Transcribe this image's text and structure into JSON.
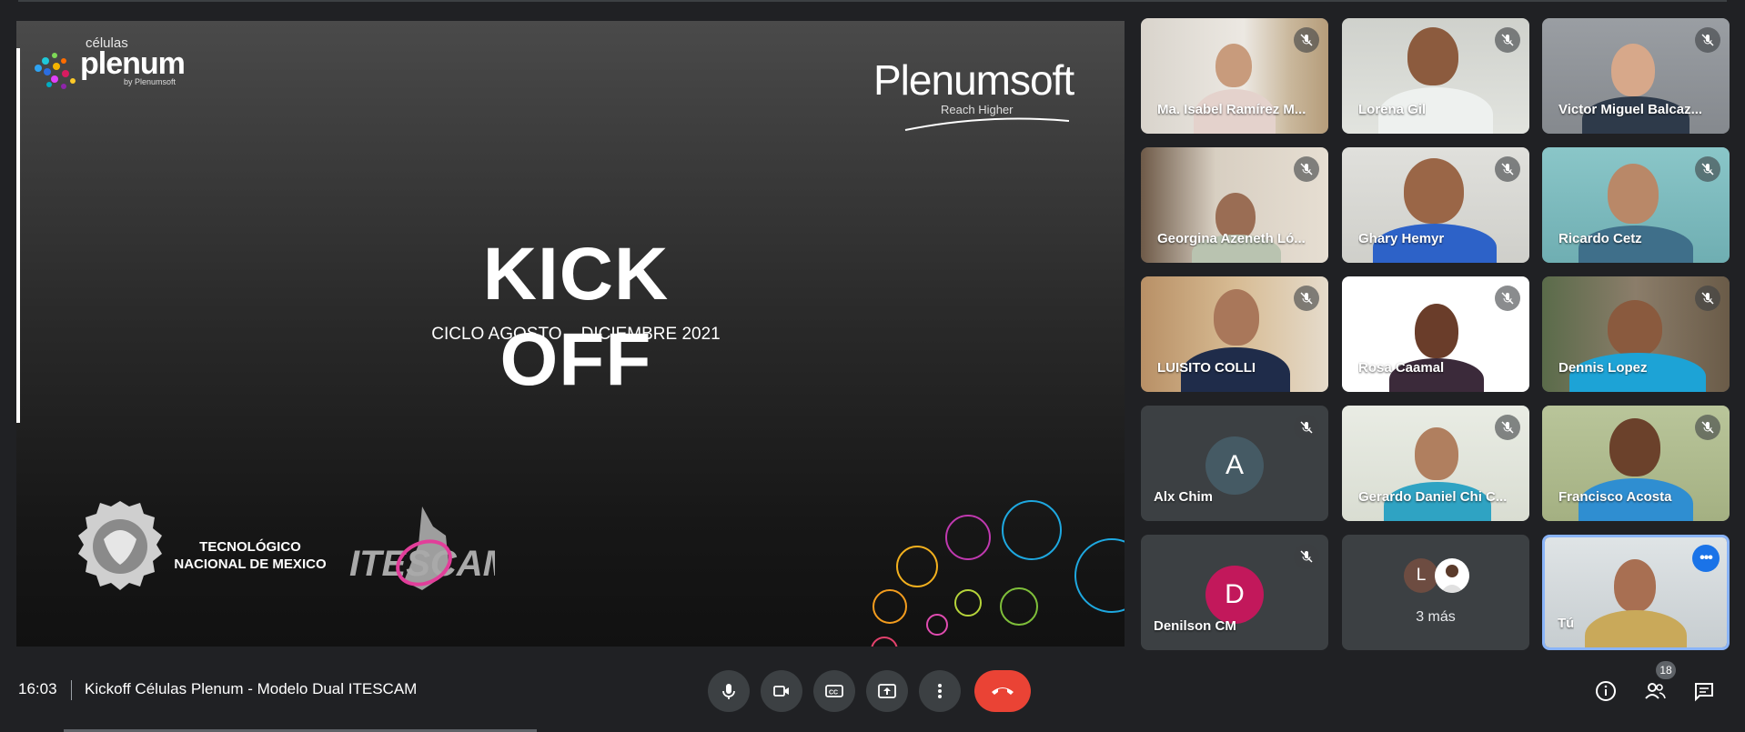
{
  "slide": {
    "brand_top": "células",
    "brand_main": "plenum",
    "brand_by": "by Plenumsoft",
    "partner_logo": "Plenumsoft",
    "partner_tagline": "Reach Higher",
    "headline": "KICK OFF",
    "subtitle": "CICLO AGOSTO – DICIEMBRE 2021",
    "institution_line1": "TECNOLÓGICO",
    "institution_line2": "NACIONAL DE MEXICO",
    "logo_text": "ITESCAM"
  },
  "participants": [
    {
      "name": "Ma. Isabel Ramírez M...",
      "muted": true
    },
    {
      "name": "Lorena Gil",
      "muted": true
    },
    {
      "name": "Victor Miguel Balcaz...",
      "muted": true
    },
    {
      "name": "Georgina Azeneth Ló...",
      "muted": true
    },
    {
      "name": "Ghary Hemyr",
      "muted": true
    },
    {
      "name": "Ricardo Cetz",
      "muted": true
    },
    {
      "name": "LUISITO COLLI",
      "muted": true
    },
    {
      "name": "Rosa Caamal",
      "muted": true
    },
    {
      "name": "Dennis Lopez",
      "muted": true
    },
    {
      "name": "Alx Chim",
      "initial": "A",
      "muted": true
    },
    {
      "name": "Gerardo Daniel Chi C...",
      "muted": true
    },
    {
      "name": "Francisco Acosta",
      "muted": true
    },
    {
      "name": "Denilson CM",
      "initial": "D",
      "muted": true
    }
  ],
  "more_tile": {
    "initial": "L",
    "label": "3 más"
  },
  "self_tile": {
    "name": "Tú"
  },
  "footer": {
    "time": "16:03",
    "meeting_title": "Kickoff Células Plenum - Modelo Dual ITESCAM",
    "participant_count": "18"
  },
  "colors": {
    "background": "#202124",
    "end_call": "#ea4335",
    "self_highlight": "#8ab4f8",
    "accent": "#1a73e8"
  },
  "icons": [
    "mic-icon",
    "camera-icon",
    "captions-icon",
    "present-icon",
    "more-options-icon",
    "end-call-icon",
    "info-icon",
    "people-icon",
    "chat-icon",
    "mic-off-icon"
  ]
}
